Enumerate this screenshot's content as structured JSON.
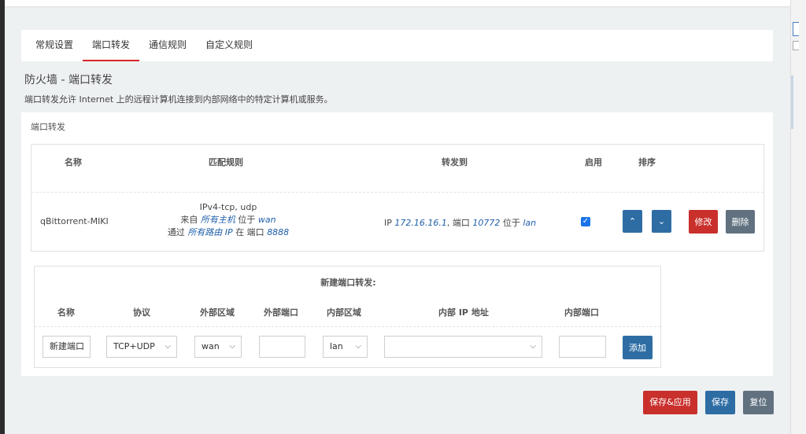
{
  "tabs": [
    "常规设置",
    "端口转发",
    "通信规则",
    "自定义规则"
  ],
  "page": {
    "title": "防火墙 - 端口转发",
    "description": "端口转发允许 Internet 上的远程计算机连接到内部网络中的特定计算机或服务。"
  },
  "section": {
    "title": "端口转发",
    "headers": [
      "名称",
      "匹配规则",
      "转发到",
      "启用",
      "排序"
    ]
  },
  "rule": {
    "name": "qBittorrent-MIKI",
    "match_line1": "IPv4-tcp, udp",
    "from_label": "来自",
    "from_host": "所有主机",
    "at_label": "位于",
    "from_zone": "wan",
    "via_label": "通过",
    "via_ip": "所有路由 IP",
    "in_label": "在 端口",
    "port": "8888",
    "fwd_ip_label": "IP",
    "fwd_ip": "172.16.16.1",
    "fwd_port_label": ", 端口",
    "fwd_port": "10772",
    "fwd_at_label": "位于",
    "fwd_zone": "lan",
    "enabled": true,
    "edit_label": "修改",
    "delete_label": "删除"
  },
  "new_forward": {
    "title": "新建端口转发:",
    "headers": [
      "名称",
      "协议",
      "外部区域",
      "外部端口",
      "内部区域",
      "内部 IP 地址",
      "内部端口"
    ],
    "name_value": "新建端口",
    "protocol": "TCP+UDP",
    "ext_zone": "wan",
    "ext_port": "",
    "int_zone": "lan",
    "int_ip": "",
    "int_port": "",
    "add_label": "添加"
  },
  "footer": {
    "save_apply": "保存&应用",
    "save": "保存",
    "reset": "复位"
  },
  "colors": {
    "accent_red": "#c9302c",
    "primary_blue": "#2e6da4",
    "gray": "#617180",
    "link_blue": "#1f5fa9"
  }
}
